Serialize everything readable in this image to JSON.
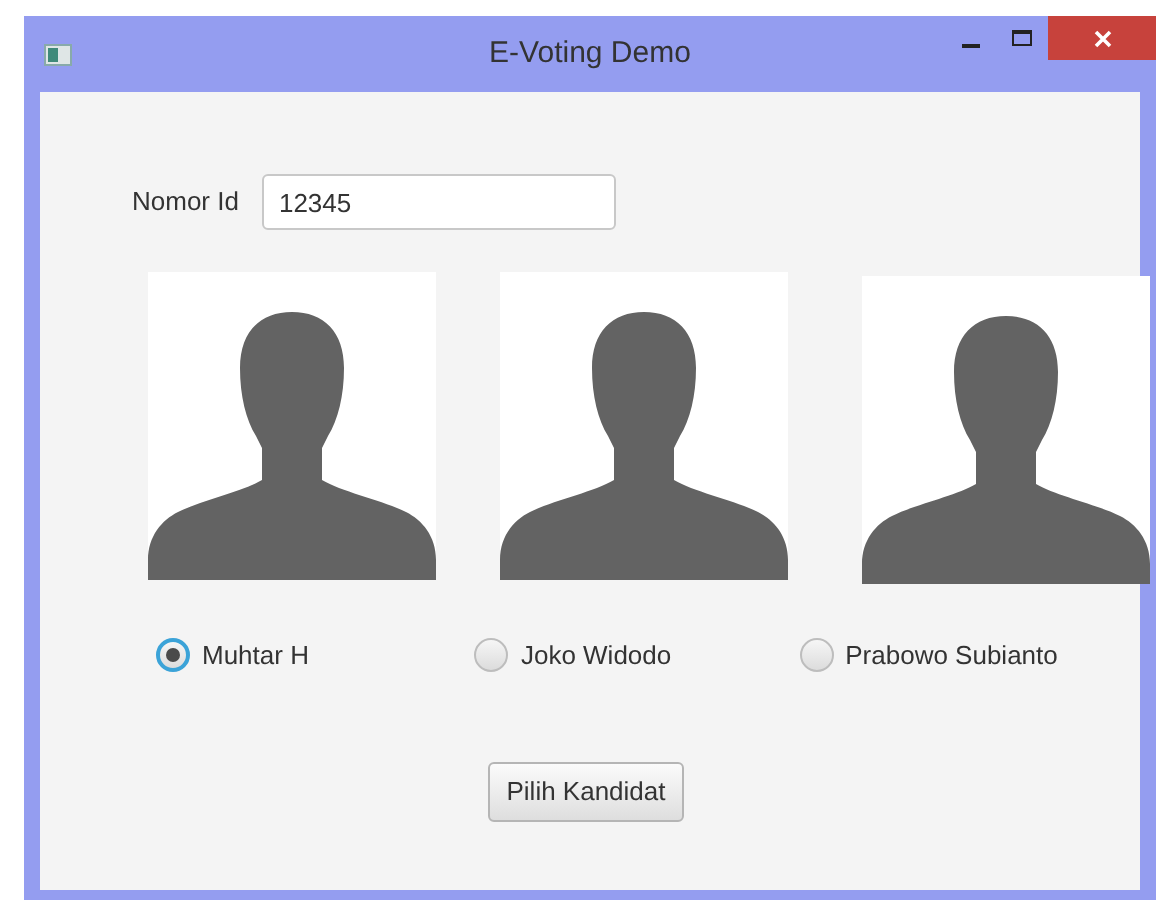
{
  "window": {
    "title": "E-Voting Demo"
  },
  "id_field": {
    "label": "Nomor Id",
    "value": "12345"
  },
  "candidates": [
    {
      "name": "Muhtar H",
      "selected": true
    },
    {
      "name": "Joko Widodo",
      "selected": false
    },
    {
      "name": "Prabowo Subianto",
      "selected": false
    }
  ],
  "submit_button": "Pilih Kandidat"
}
